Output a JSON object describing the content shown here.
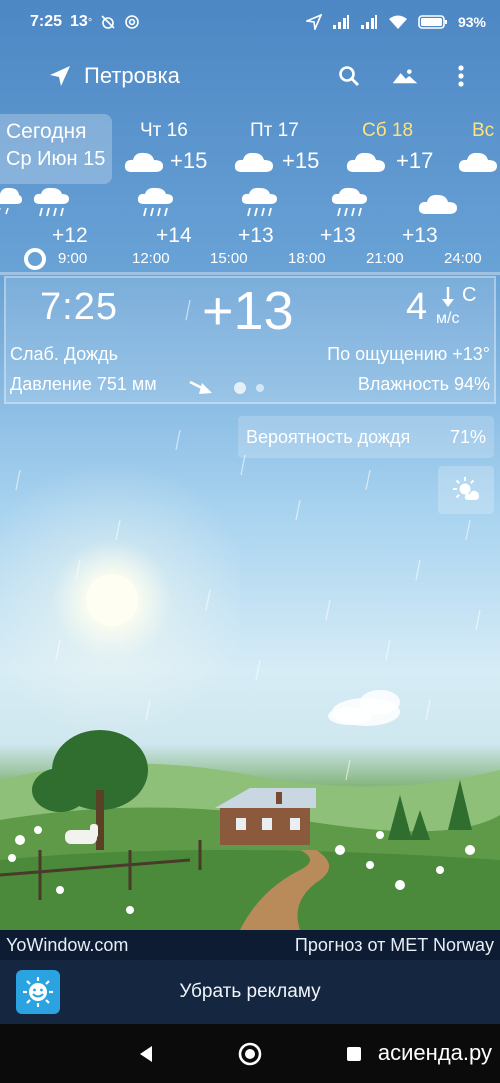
{
  "status_bar": {
    "time": "7:25",
    "notification_temp": "13",
    "notification_temp_deg": "°",
    "battery": "93%",
    "icons": [
      "alarm-off-icon",
      "at-sign-icon",
      "location-arrow-icon",
      "signal-icon",
      "signal-icon",
      "wifi-icon",
      "battery-icon"
    ]
  },
  "app_bar": {
    "location": "Петровка",
    "icons": [
      "location-arrow-icon",
      "search-icon",
      "landscape-icon",
      "more-vert-icon"
    ]
  },
  "days": {
    "today_label": "Сегодня",
    "today_date": "Ср Июн 15",
    "items": [
      {
        "name": "Чт 16",
        "temp": "+15",
        "icon": "cloud-icon",
        "weekend": false
      },
      {
        "name": "Пт 17",
        "temp": "+15",
        "icon": "cloud-icon",
        "weekend": false
      },
      {
        "name": "Сб 18",
        "temp": "+17",
        "icon": "cloud-icon",
        "weekend": true
      },
      {
        "name": "Вс",
        "temp": "",
        "icon": "cloud-icon",
        "weekend": true
      }
    ]
  },
  "hourly": [
    {
      "time": "9:00",
      "temp": "+12",
      "icon": "cloud-rain-icon"
    },
    {
      "time": "12:00",
      "temp": "+14",
      "icon": "cloud-rain-icon"
    },
    {
      "time": "15:00",
      "temp": "+13",
      "icon": "cloud-rain-icon"
    },
    {
      "time": "18:00",
      "temp": "+13",
      "icon": "cloud-rain-icon"
    },
    {
      "time": "21:00",
      "temp": "+13",
      "icon": "cloud-icon"
    },
    {
      "time": "24:00",
      "temp": "",
      "icon": ""
    }
  ],
  "current": {
    "time": "7:25",
    "temp": "+13",
    "wind_speed": "4",
    "wind_dir": "С",
    "wind_unit": "м/с",
    "condition": "Слаб. Дождь",
    "feels_like": "По ощущению +13°",
    "pressure": "Давление 751 мм",
    "humidity": "Влажность 94%"
  },
  "rain_chance": {
    "label": "Вероятность дождя",
    "value": "71%"
  },
  "credits": {
    "left": "YoWindow.com",
    "right": "Прогноз от MET Norway"
  },
  "ad": {
    "label": "Убрать рекламу"
  },
  "watermark": "асиенда.ру",
  "colors": {
    "weekend": "#ffe27a",
    "credits_bg": "#0d1b33",
    "ad_bg": "#152640"
  }
}
